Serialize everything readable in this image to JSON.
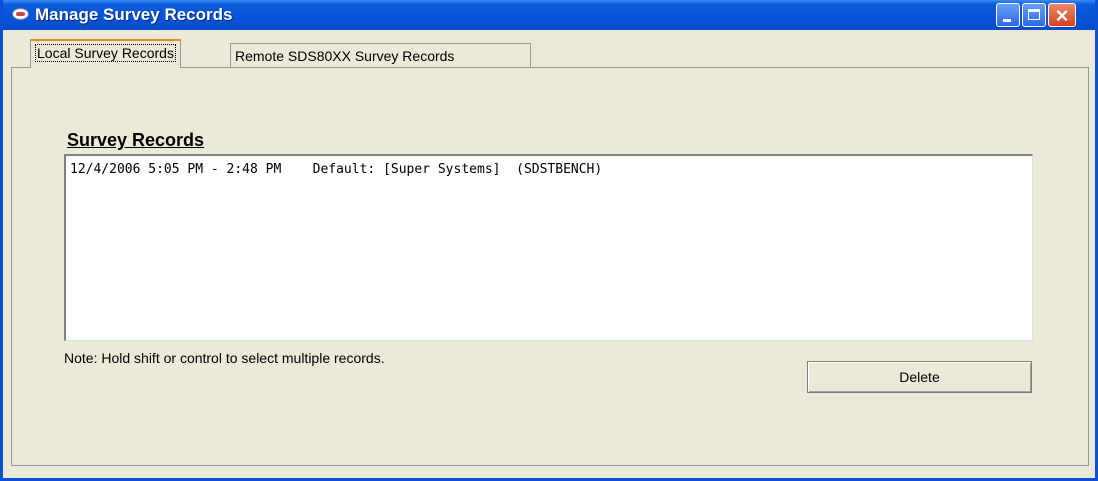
{
  "window": {
    "title": "Manage Survey Records"
  },
  "tabs": [
    {
      "label": "Local Survey Records",
      "active": true
    },
    {
      "label": "Remote SDS80XX Survey Records",
      "active": false
    }
  ],
  "section": {
    "label": "Survey Records"
  },
  "records": [
    {
      "text": "12/4/2006 5:05 PM - 2:48 PM    Default: [Super Systems]  (SDSTBENCH)"
    }
  ],
  "note": "Note: Hold shift or control to select multiple records.",
  "buttons": {
    "delete": "Delete"
  },
  "icons": {
    "app": "app-icon",
    "minimize": "minimize-icon",
    "maximize": "maximize-icon",
    "close": "close-icon"
  },
  "colors": {
    "titlebar": "#0653d8",
    "close_button": "#d5431f",
    "active_tab_accent": "#e68b2c",
    "surface": "#ece9d8"
  }
}
